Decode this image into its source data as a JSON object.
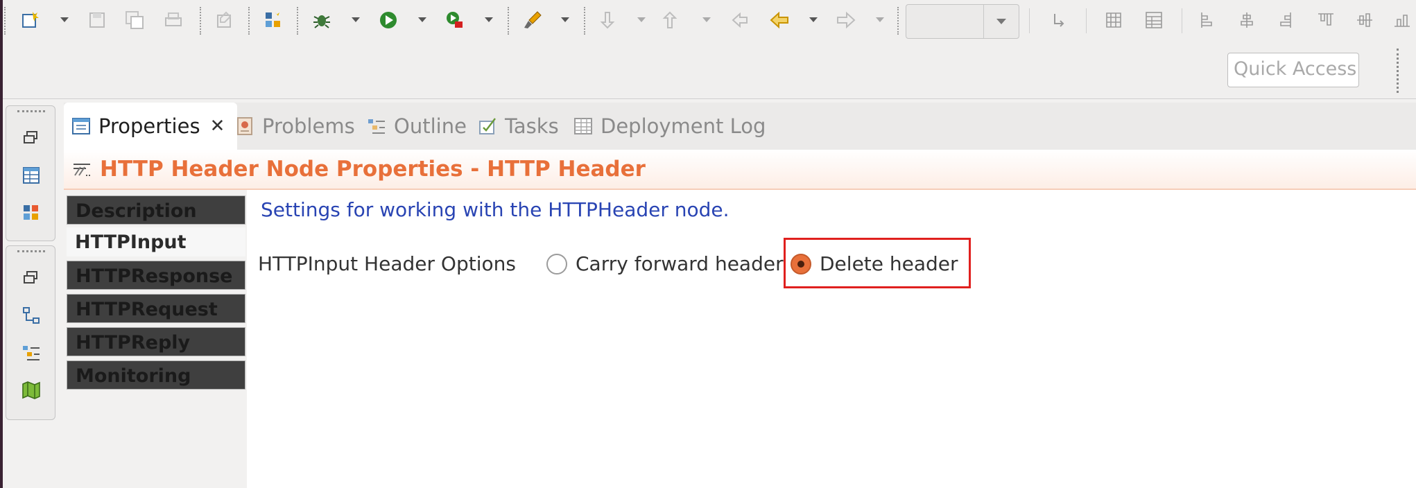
{
  "window": {
    "accent_color": "#e8703a",
    "highlight_color": "#e0201e"
  },
  "toolbar": {
    "icons": [
      "new-icon",
      "save-icon",
      "save-all-icon",
      "print-icon",
      "properties-icon",
      "deploy-icon",
      "debug-icon",
      "run-icon",
      "run-stop-icon",
      "brush-icon",
      "next-annotation-icon",
      "previous-annotation-icon",
      "last-edit-icon",
      "back-icon",
      "forward-icon",
      "step-icon",
      "grid-icon",
      "table-icon",
      "align-icons"
    ],
    "combo_value": "",
    "quick_access_placeholder": "Quick Access"
  },
  "tabs": [
    {
      "label": "Properties",
      "active": true,
      "icon": "properties-view-icon"
    },
    {
      "label": "Problems",
      "active": false,
      "icon": "problems-icon"
    },
    {
      "label": "Outline",
      "active": false,
      "icon": "outline-icon"
    },
    {
      "label": "Tasks",
      "active": false,
      "icon": "tasks-icon"
    },
    {
      "label": "Deployment Log",
      "active": false,
      "icon": "deployment-log-icon"
    }
  ],
  "panel": {
    "title": "HTTP Header Node Properties - HTTP Header",
    "side_tabs": [
      "Description",
      "HTTPInput",
      "HTTPResponse",
      "HTTPRequest",
      "HTTPReply",
      "Monitoring"
    ],
    "selected_side_tab": "HTTPInput",
    "description": "Settings for working with the HTTPHeader node.",
    "option_label": "HTTPInput Header Options",
    "options": [
      {
        "label": "Carry forward header",
        "selected": false
      },
      {
        "label": "Delete header",
        "selected": true
      }
    ]
  }
}
